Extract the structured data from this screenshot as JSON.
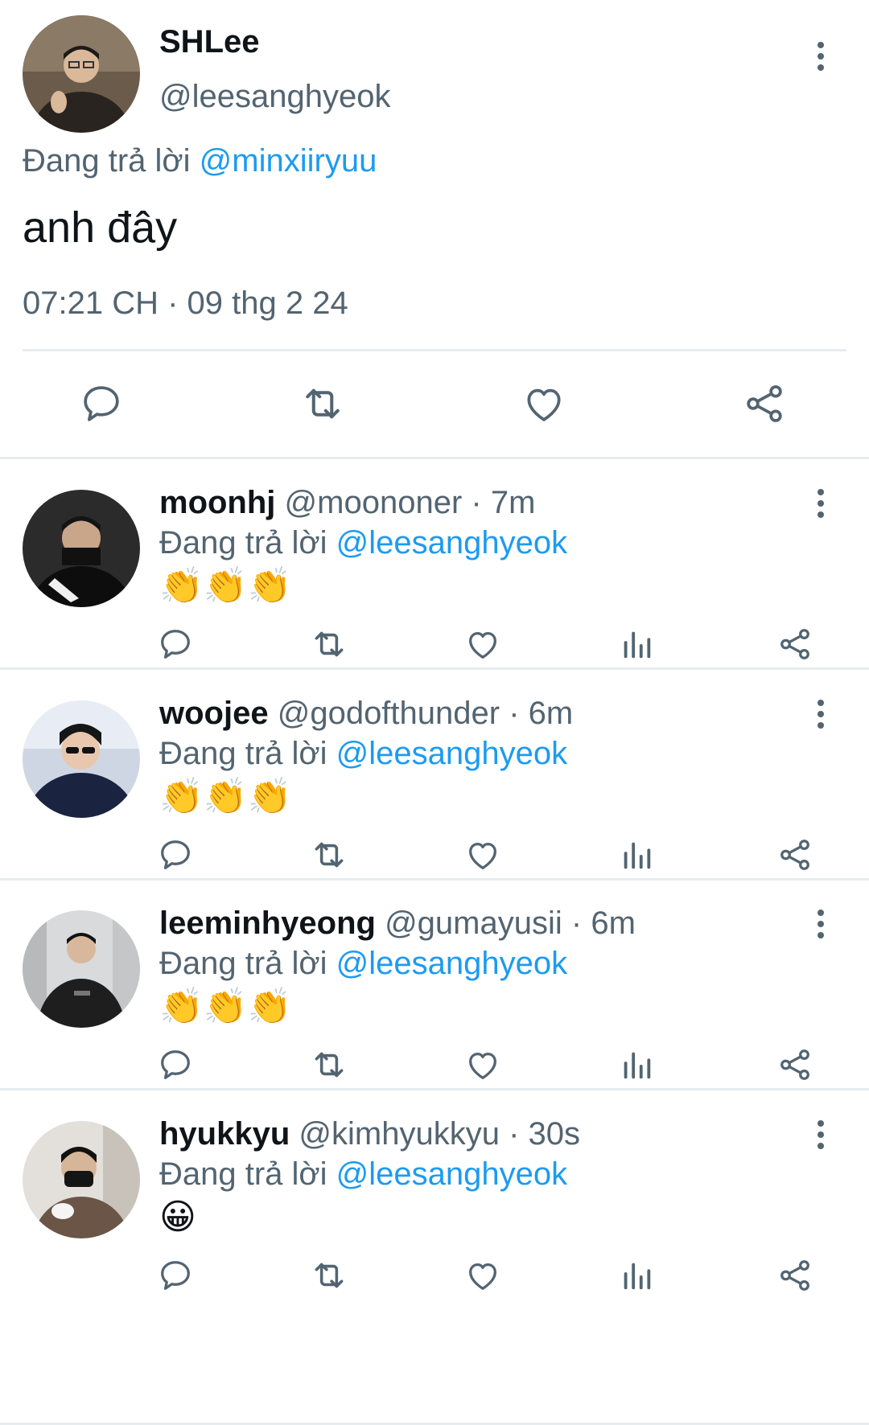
{
  "main_tweet": {
    "display_name": "SHLee",
    "handle": "@leesanghyeok",
    "replying_prefix": "Đang trả lời",
    "replying_to": "@minxiiryuu",
    "text": "anh đây",
    "timestamp": "07:21 CH · 09 thg 2 24",
    "actions": [
      "reply-icon",
      "retweet-icon",
      "like-icon",
      "share-icon"
    ]
  },
  "replies": [
    {
      "display_name": "moonhj",
      "handle": "@moononer",
      "time": "· 7m",
      "replying_prefix": "Đang trả lời",
      "replying_to": "@leesanghyeok",
      "content": "👏👏👏"
    },
    {
      "display_name": "woojee",
      "handle": "@godofthunder",
      "time": "· 6m",
      "replying_prefix": "Đang trả lời",
      "replying_to": "@leesanghyeok",
      "content": "👏👏👏"
    },
    {
      "display_name": "leeminhyeong",
      "handle": "@gumayusii",
      "time": "· 6m",
      "replying_prefix": "Đang trả lời",
      "replying_to": "@leesanghyeok",
      "content": "👏👏👏"
    },
    {
      "display_name": "hyukkyu",
      "handle": "@kimhyukkyu",
      "time": "· 30s",
      "replying_prefix": "Đang trả lời",
      "replying_to": "@leesanghyeok",
      "content": "😀"
    }
  ],
  "colors": {
    "accent": "#1d9bf0",
    "secondary_text": "#536471",
    "primary_text": "#0f1419",
    "divider": "#e6ecf0"
  }
}
